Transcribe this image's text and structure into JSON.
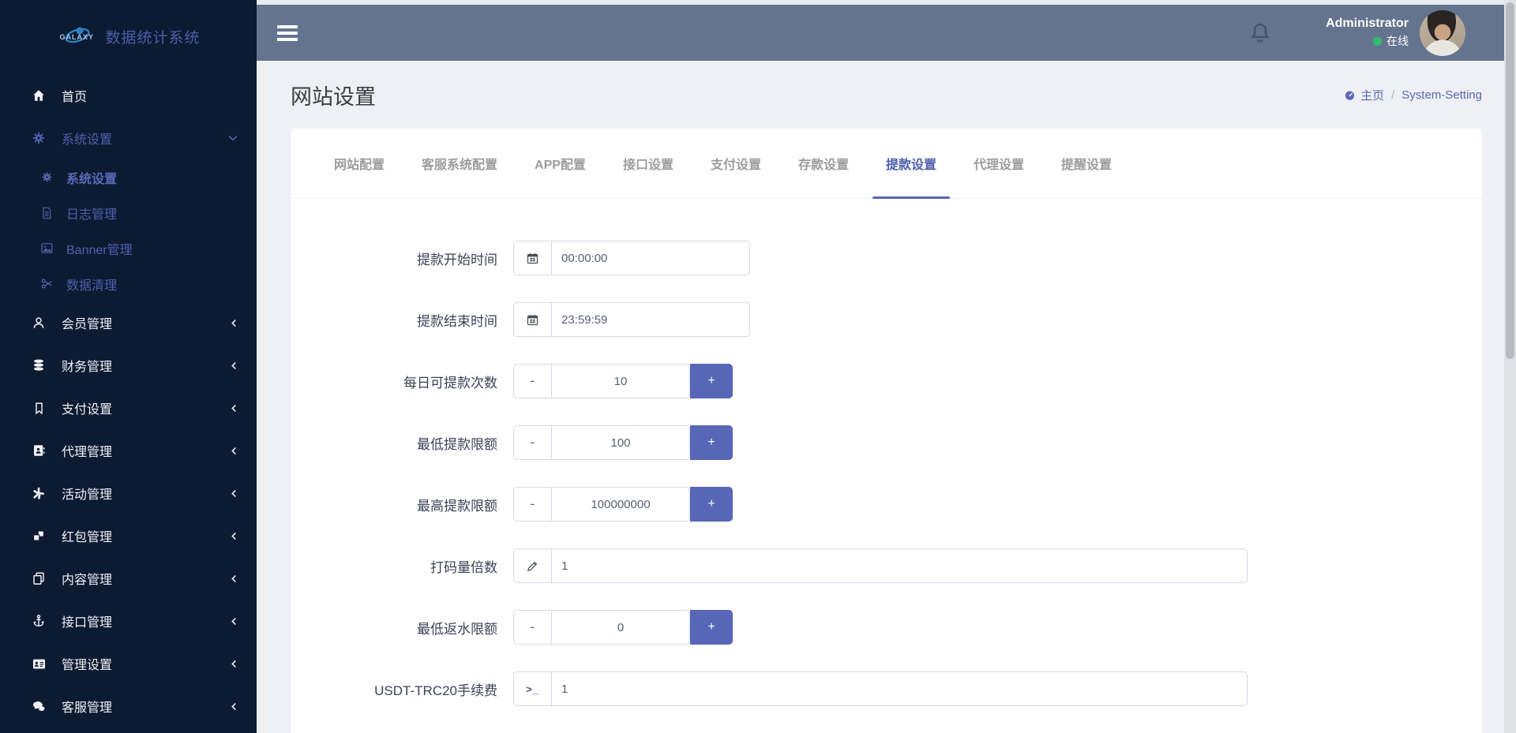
{
  "brand": {
    "logo": "GALAXY",
    "title": "数据统计系统"
  },
  "topbar": {
    "user": "Administrator",
    "status": "在线"
  },
  "sidebar": [
    {
      "label": "首页",
      "icon": "home-icon"
    },
    {
      "label": "系统设置",
      "icon": "gears-icon"
    },
    {
      "label": "系统设置",
      "icon": "gear-icon"
    },
    {
      "label": "日志管理",
      "icon": "file-icon"
    },
    {
      "label": "Banner管理",
      "icon": "image-icon"
    },
    {
      "label": "数据清理",
      "icon": "scissors-icon"
    },
    {
      "label": "会员管理",
      "icon": "user-icon"
    },
    {
      "label": "财务管理",
      "icon": "database-icon"
    },
    {
      "label": "支付设置",
      "icon": "bookmark-icon"
    },
    {
      "label": "代理管理",
      "icon": "address-book-icon"
    },
    {
      "label": "活动管理",
      "icon": "burst-icon"
    },
    {
      "label": "红包管理",
      "icon": "cubes-icon"
    },
    {
      "label": "内容管理",
      "icon": "copy-icon"
    },
    {
      "label": "接口管理",
      "icon": "anchor-icon"
    },
    {
      "label": "管理设置",
      "icon": "id-card-icon"
    },
    {
      "label": "客服管理",
      "icon": "comments-icon"
    }
  ],
  "page": {
    "title": "网站设置",
    "breadcrumb_home": "主页",
    "breadcrumb_sep": "/",
    "breadcrumb_current": "System-Setting"
  },
  "tabs": [
    {
      "label": "网站配置"
    },
    {
      "label": "客服系统配置"
    },
    {
      "label": "APP配置"
    },
    {
      "label": "接口设置"
    },
    {
      "label": "支付设置"
    },
    {
      "label": "存款设置"
    },
    {
      "label": "提款设置",
      "active": true
    },
    {
      "label": "代理设置"
    },
    {
      "label": "提醒设置"
    }
  ],
  "form": {
    "minus": "-",
    "plus": "+",
    "terminal_glyph": ">_",
    "rows": [
      {
        "label": "提款开始时间",
        "value": "00:00:00",
        "icon": "calendar-icon"
      },
      {
        "label": "提款结束时间",
        "value": "23:59:59",
        "icon": "calendar-icon"
      },
      {
        "label": "每日可提款次数",
        "value": "10"
      },
      {
        "label": "最低提款限额",
        "value": "100"
      },
      {
        "label": "最高提款限额",
        "value": "100000000"
      },
      {
        "label": "打码量倍数",
        "value": "1",
        "icon": "pencil-icon"
      },
      {
        "label": "最低返水限额",
        "value": "0"
      },
      {
        "label": "USDT-TRC20手续费",
        "value": "1",
        "icon": "terminal-icon"
      }
    ]
  },
  "colors": {
    "accent": "#5766b7",
    "sidebar_bg": "#0d1b32",
    "header_bg": "#64748f",
    "online_green": "#2dbd6e",
    "page_bg": "#eef0f5",
    "active_tab": "#4d5ead"
  }
}
